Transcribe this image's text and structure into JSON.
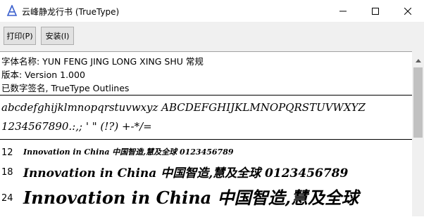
{
  "window": {
    "title": "云峰静龙行书 (TrueType)",
    "icon": "font-app-icon",
    "controls": [
      "minimize-icon",
      "maximize-icon",
      "close-icon"
    ]
  },
  "toolbar": {
    "print_label": "打印(P)",
    "install_label": "安装(I)"
  },
  "info": {
    "font_name": "字体名称: YUN FENG JING LONG XING SHU 常规",
    "version": "版本: Version 1.000",
    "signature": "已数字签名, TrueType Outlines"
  },
  "charset": {
    "line1": "abcdefghijklmnopqrstuvwxyz ABCDEFGHIJKLMNOPQRSTUVWXYZ",
    "line2": "1234567890.:,; ' \" (!?) +-*/="
  },
  "samples": [
    {
      "size": "12",
      "text": "Innovation in China 中国智造,慧及全球 0123456789"
    },
    {
      "size": "18",
      "text": "Innovation in China 中国智造,慧及全球 0123456789"
    },
    {
      "size": "24",
      "text": "Innovation in China 中国智造,慧及全球"
    }
  ]
}
